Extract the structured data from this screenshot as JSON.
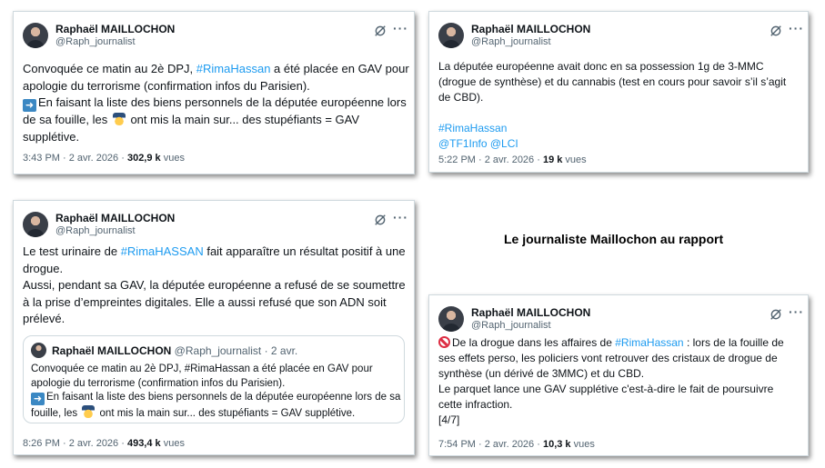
{
  "author": {
    "name": "Raphaël MAILLOCHON",
    "handle": "@Raph_journalist"
  },
  "icons": {
    "grok": "grok-icon",
    "more": "more-icon",
    "more_glyph": "···",
    "arrow_emoji": "right-arrow-emoji",
    "police_emoji": "police-officer-emoji",
    "prohibited_emoji": "prohibited-emoji"
  },
  "colors": {
    "link": "#1d9bf0",
    "muted": "#536471",
    "border": "#cfd9de"
  },
  "caption": "Le journaliste Maillochon au rapport",
  "tweets": [
    {
      "line1_a": "Convoquée ce matin au 2è DPJ, ",
      "line1_link": "#RimaHassan",
      "line1_b": " a été placée en GAV pour",
      "line2": "apologie du terrorisme (confirmation infos du Parisien).",
      "line3": "En faisant la liste des biens personnels de la députée européenne lors",
      "line4_a": "de sa fouille, les ",
      "line4_b": " ont mis la main sur... des stupéfiants = GAV",
      "line5": "supplétive.",
      "time": "3:43 PM · 2 avr. 2026 · ",
      "views": "302,9 k",
      "views_label": " vues"
    },
    {
      "line1": "La députée européenne avait donc en sa possession 1g de 3-MMC",
      "line2": "(drogue de synthèse) et du cannabis (test en cours pour savoir s’il s’agit",
      "line3": "de CBD).",
      "hashtag": "#RimaHassan",
      "mentions": "@TF1Info @LCI",
      "time": "5:22 PM · 2 avr. 2026 · ",
      "views": "19 k",
      "views_label": " vues"
    },
    {
      "line1_a": "Le test urinaire de ",
      "line1_link": "#RimaHASSAN",
      "line1_b": " fait apparaître un résultat positif à une",
      "line2": "drogue.",
      "line3": "Aussi, pendant sa GAV, la députée européenne a refusé de se soumettre",
      "line4": "à la prise d’empreintes digitales. Elle a aussi refusé que son ADN soit",
      "line5": "prélevé.",
      "quote": {
        "name": "Raphaël MAILLOCHON",
        "meta": " @Raph_journalist · 2 avr.",
        "line1": "Convoquée ce matin au 2è DPJ, #RimaHassan a été placée en GAV pour",
        "line2": "apologie du terrorisme (confirmation infos du Parisien).",
        "line3": "En faisant la liste des biens personnels de la députée européenne lors de sa",
        "line4_a": "fouille, les ",
        "line4_b": " ont mis la main sur... des stupéfiants = GAV supplétive."
      },
      "time": "8:26 PM · 2 avr. 2026 · ",
      "views": "493,4 k",
      "views_label": " vues"
    },
    {
      "line1_a": "De la drogue dans les affaires de ",
      "line1_link": "#RimaHassan",
      "line1_b": " : lors de la fouille de",
      "line2": "ses effets perso, les policiers vont retrouver des cristaux de drogue de",
      "line3": "synthèse (un dérivé de 3MMC) et du CBD.",
      "line4": "Le parquet lance une GAV supplétive c'est-à-dire le fait de poursuivre",
      "line5": "cette infraction.",
      "line6": "[4/7]",
      "time": "7:54 PM · 2 avr. 2026 · ",
      "views": "10,3 k",
      "views_label": " vues"
    }
  ]
}
